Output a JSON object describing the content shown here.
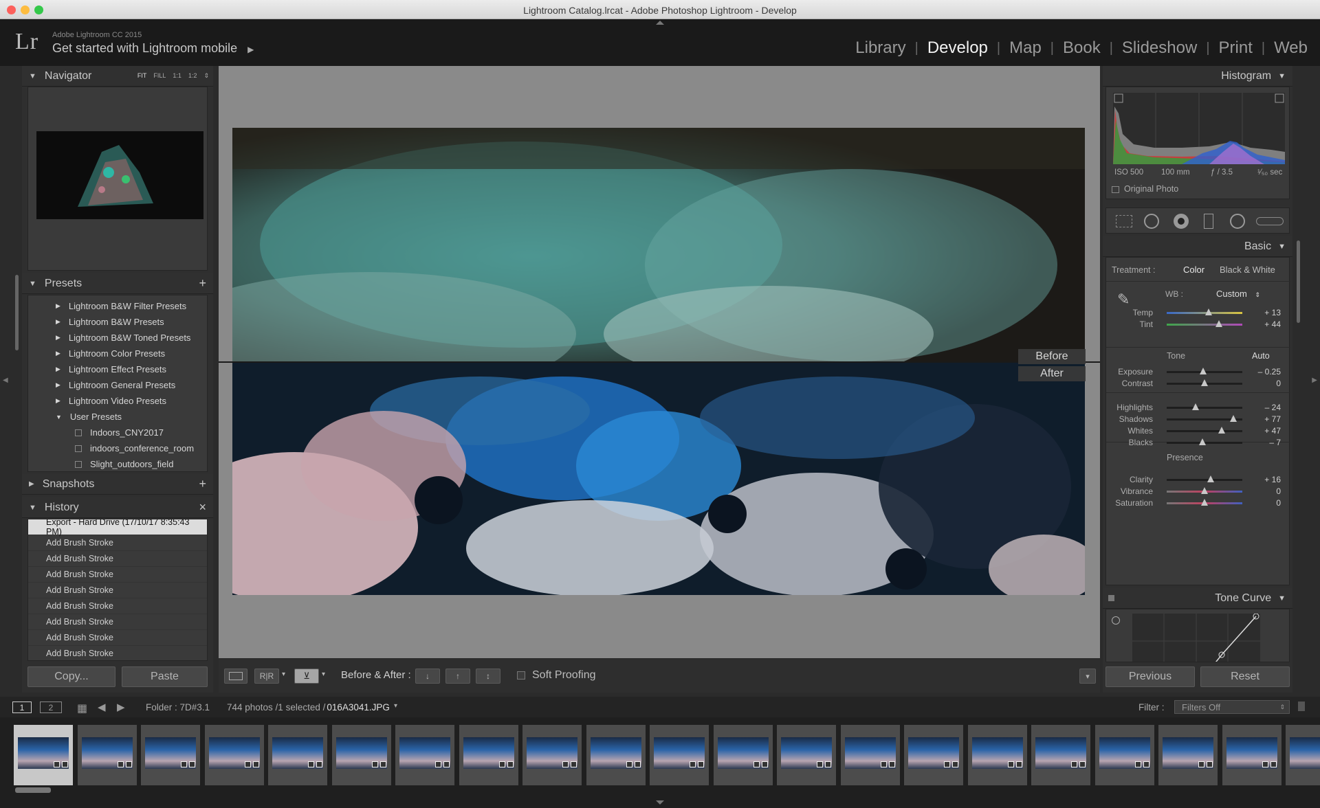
{
  "window": {
    "title": "Lightroom Catalog.lrcat - Adobe Photoshop Lightroom - Develop"
  },
  "identity": {
    "logo": "Lr",
    "app_name": "Adobe Lightroom CC 2015",
    "mobile_link": "Get started with Lightroom mobile",
    "arrow": "▶"
  },
  "modules": [
    "Library",
    "Develop",
    "Map",
    "Book",
    "Slideshow",
    "Print",
    "Web"
  ],
  "navigator": {
    "title": "Navigator",
    "zoom_options": [
      "FIT",
      "FILL",
      "1:1",
      "1:2"
    ]
  },
  "presets": {
    "title": "Presets",
    "add": "+",
    "folders": [
      "Lightroom B&W Filter Presets",
      "Lightroom B&W Presets",
      "Lightroom B&W Toned Presets",
      "Lightroom Color Presets",
      "Lightroom Effect Presets",
      "Lightroom General Presets",
      "Lightroom Video Presets",
      "User Presets"
    ],
    "user_items": [
      "Indoors_CNY2017",
      "indoors_conference_room",
      "Slight_outdoors_field"
    ]
  },
  "snapshots": {
    "title": "Snapshots",
    "add": "+"
  },
  "history": {
    "title": "History",
    "clear": "×",
    "items": [
      "Export - Hard Drive (17/10/17 8:35:43 PM)",
      "Add Brush Stroke",
      "Add Brush Stroke",
      "Add Brush Stroke",
      "Add Brush Stroke",
      "Add Brush Stroke",
      "Add Brush Stroke",
      "Add Brush Stroke",
      "Add Brush Stroke"
    ]
  },
  "left_buttons": {
    "copy": "Copy...",
    "paste": "Paste"
  },
  "view": {
    "before_label": "Before",
    "after_label": "After"
  },
  "toolbar": {
    "before_after_label": "Before & After :",
    "soft_proofing": "Soft Proofing"
  },
  "histogram": {
    "title": "Histogram",
    "iso": "ISO 500",
    "focal": "100 mm",
    "aperture": "ƒ / 3.5",
    "shutter": "¹⁄₅₀ sec",
    "original_photo": "Original Photo"
  },
  "basic": {
    "title": "Basic",
    "treatment_label": "Treatment :",
    "treatment_color": "Color",
    "treatment_bw": "Black & White",
    "wb_label": "WB :",
    "wb_value": "Custom",
    "tone_label": "Tone",
    "auto_label": "Auto",
    "presence_label": "Presence",
    "sliders": [
      {
        "label": "Temp",
        "value": "+ 13",
        "pos": 0.55,
        "group": "wb"
      },
      {
        "label": "Tint",
        "value": "+ 44",
        "pos": 0.69,
        "group": "wb"
      },
      {
        "label": "Exposure",
        "value": "– 0.25",
        "pos": 0.48,
        "group": "tone"
      },
      {
        "label": "Contrast",
        "value": "0",
        "pos": 0.5,
        "group": "tone"
      },
      {
        "label": "Highlights",
        "value": "– 24",
        "pos": 0.38,
        "group": "tone2"
      },
      {
        "label": "Shadows",
        "value": "+ 77",
        "pos": 0.88,
        "group": "tone2"
      },
      {
        "label": "Whites",
        "value": "+ 47",
        "pos": 0.73,
        "group": "tone2"
      },
      {
        "label": "Blacks",
        "value": "– 7",
        "pos": 0.47,
        "group": "tone2"
      },
      {
        "label": "Clarity",
        "value": "+ 16",
        "pos": 0.58,
        "group": "presence"
      },
      {
        "label": "Vibrance",
        "value": "0",
        "pos": 0.5,
        "group": "presence"
      },
      {
        "label": "Saturation",
        "value": "0",
        "pos": 0.5,
        "group": "presence"
      }
    ]
  },
  "tone_curve": {
    "title": "Tone Curve"
  },
  "right_buttons": {
    "previous": "Previous",
    "reset": "Reset"
  },
  "filmstrip": {
    "screen1": "1",
    "screen2": "2",
    "folder": "Folder : 7D#3.1",
    "count": "744 photos /1 selected /",
    "filename": "016A3041.JPG",
    "filter_label": "Filter :",
    "filter_value": "Filters Off"
  },
  "colors": {
    "bg": "#2b2b2b",
    "panel": "#2f2f2f",
    "active_module": "#f2f2f2"
  }
}
